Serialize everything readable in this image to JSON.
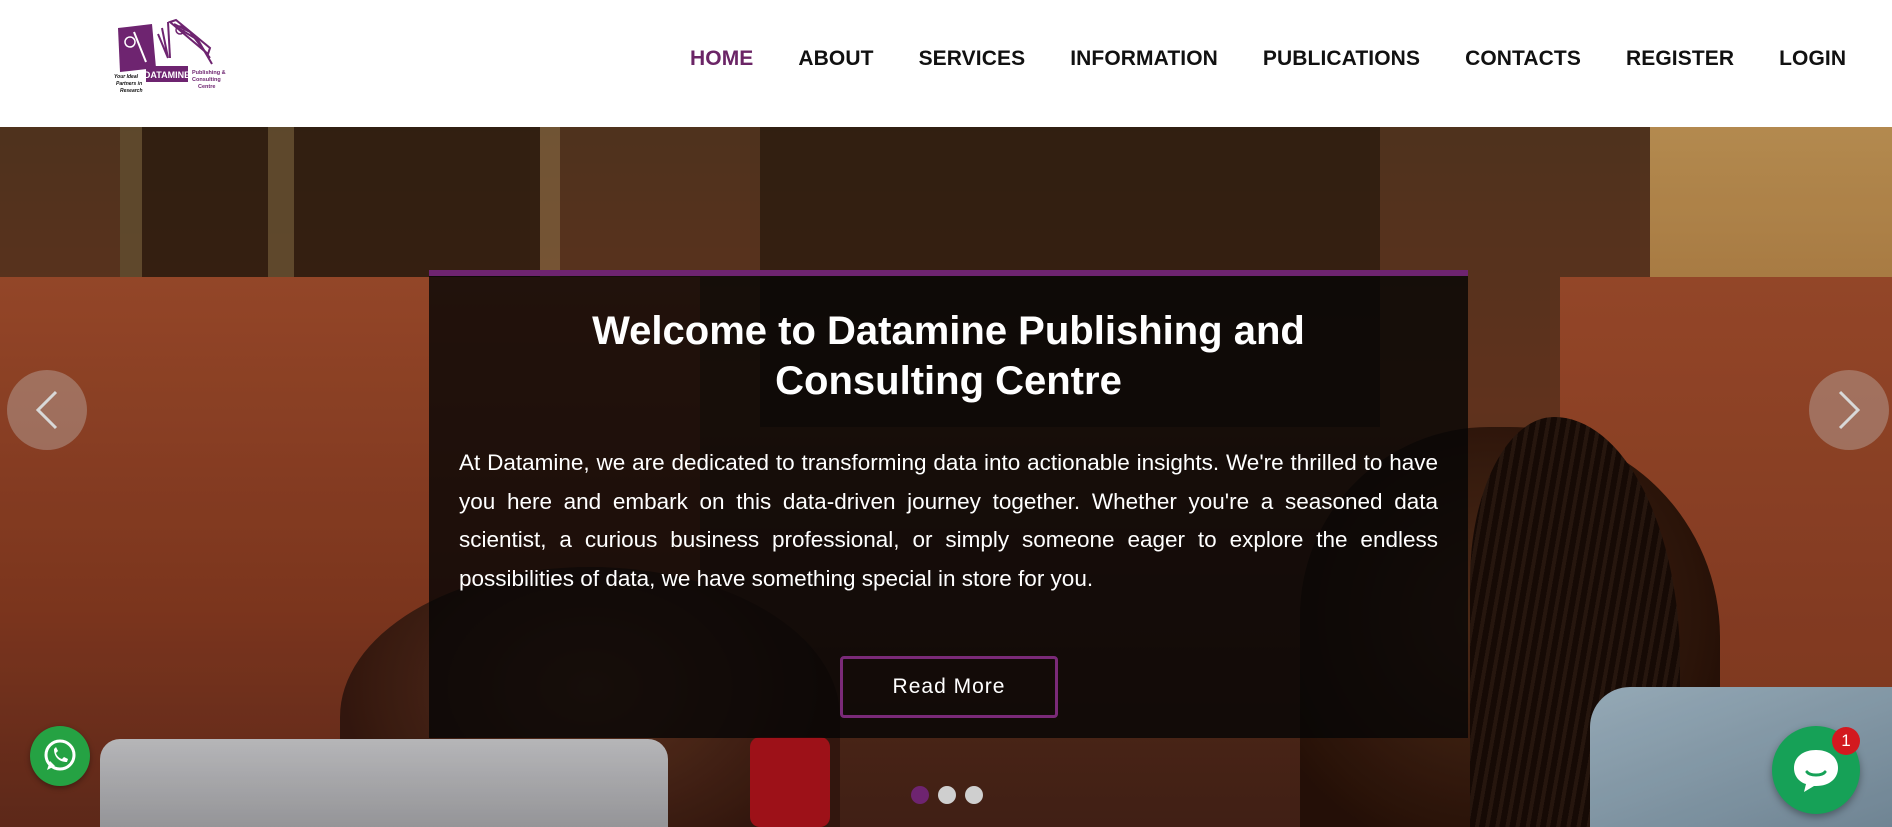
{
  "logo": {
    "brand_text": "DATAMINE",
    "tagline": "Your Ideal Partners in Research",
    "subtitle": "Publishing & Consulting Centre",
    "color": "#6e2470"
  },
  "nav": {
    "items": [
      {
        "label": "HOME",
        "active": true
      },
      {
        "label": "ABOUT",
        "active": false
      },
      {
        "label": "SERVICES",
        "active": false
      },
      {
        "label": "INFORMATION",
        "active": false
      },
      {
        "label": "PUBLICATIONS",
        "active": false
      },
      {
        "label": "CONTACTS",
        "active": false
      },
      {
        "label": "REGISTER",
        "active": false
      },
      {
        "label": "LOGIN",
        "active": false
      }
    ],
    "active_color": "#6b2566"
  },
  "hero": {
    "title": "Welcome to Datamine Publishing and Consulting Centre",
    "body": "At Datamine, we are dedicated to transforming data into actionable insights. We're thrilled to have you here and embark on this data-driven journey together. Whether you're a seasoned data scientist, a curious business professional, or simply someone eager to explore the endless possibilities of data, we have something special in store for you.",
    "read_more_label": "Read More",
    "accent_color": "#6e2470",
    "slides_count": 3,
    "active_slide": 1,
    "prev_icon": "chevron-left-icon",
    "next_icon": "chevron-right-icon"
  },
  "widgets": {
    "whatsapp_icon": "whatsapp-icon",
    "whatsapp_color": "#25a243",
    "chat_icon": "chat-bubble-icon",
    "chat_color": "#16a157",
    "chat_badge_count": "1",
    "badge_color": "#d3191f"
  }
}
